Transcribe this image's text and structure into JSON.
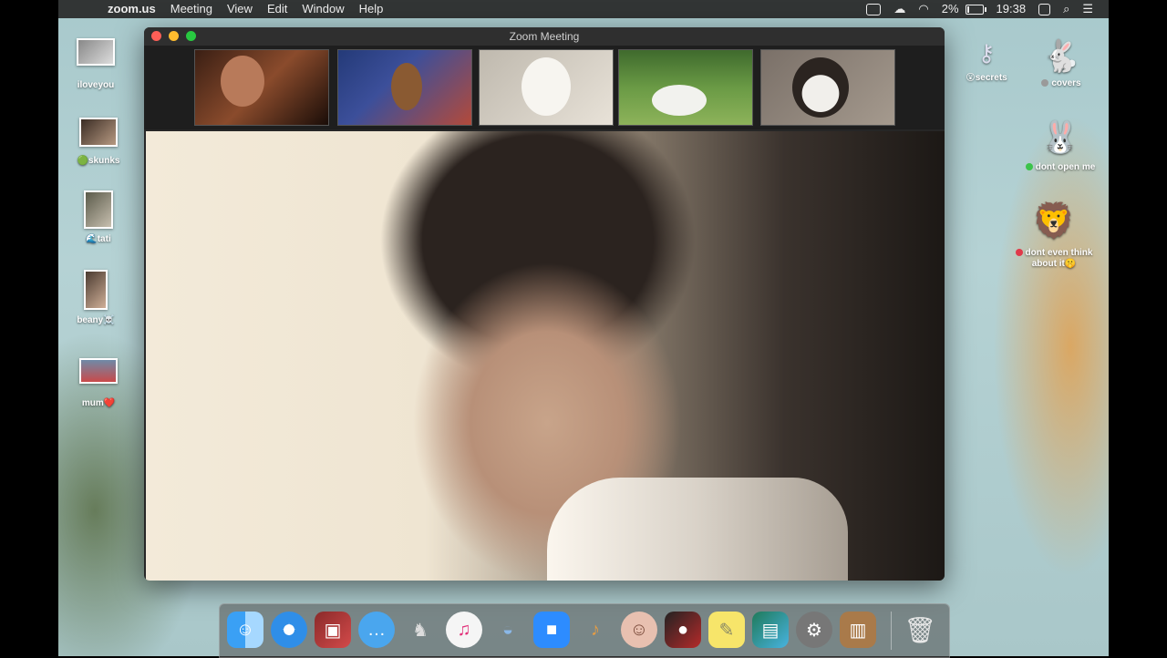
{
  "menubar": {
    "app_name": "zoom.us",
    "menus": [
      "Meeting",
      "View",
      "Edit",
      "Window",
      "Help"
    ],
    "battery_percent": "2%",
    "clock": "19:38"
  },
  "desktop": {
    "left_icons": [
      {
        "label": "iloveyou"
      },
      {
        "label": "skunks",
        "tag": "🟢"
      },
      {
        "label": "tati",
        "tag": "🌊"
      },
      {
        "label": "beany",
        "tag": "☠️"
      },
      {
        "label": "mum",
        "tag": "❤️"
      }
    ],
    "right_icons": [
      {
        "label": "secrets",
        "tag": "😮"
      },
      {
        "label": "covers"
      },
      {
        "label": "dont open me"
      },
      {
        "label": "dont even think about it",
        "tag": "🤫"
      }
    ]
  },
  "zoom_window": {
    "title": "Zoom Meeting",
    "participants": [
      "participant-1",
      "participant-2",
      "participant-3",
      "participant-4",
      "participant-5"
    ]
  },
  "dock": {
    "apps": [
      "finder-icon",
      "safari-icon",
      "photo-booth-icon",
      "messages-icon",
      "ai-icon",
      "itunes-icon",
      "seal-icon",
      "zoom-icon",
      "garageband-icon",
      "face-icon",
      "dark-app-icon",
      "stickies-icon",
      "preview-icon",
      "system-preferences-icon",
      "contacts-icon",
      "trash-icon"
    ]
  },
  "colors": {
    "close": "#fe5f57",
    "minimize": "#febc2e",
    "zoom_green": "#28c840",
    "zoom_blue": "#2d8cff"
  }
}
